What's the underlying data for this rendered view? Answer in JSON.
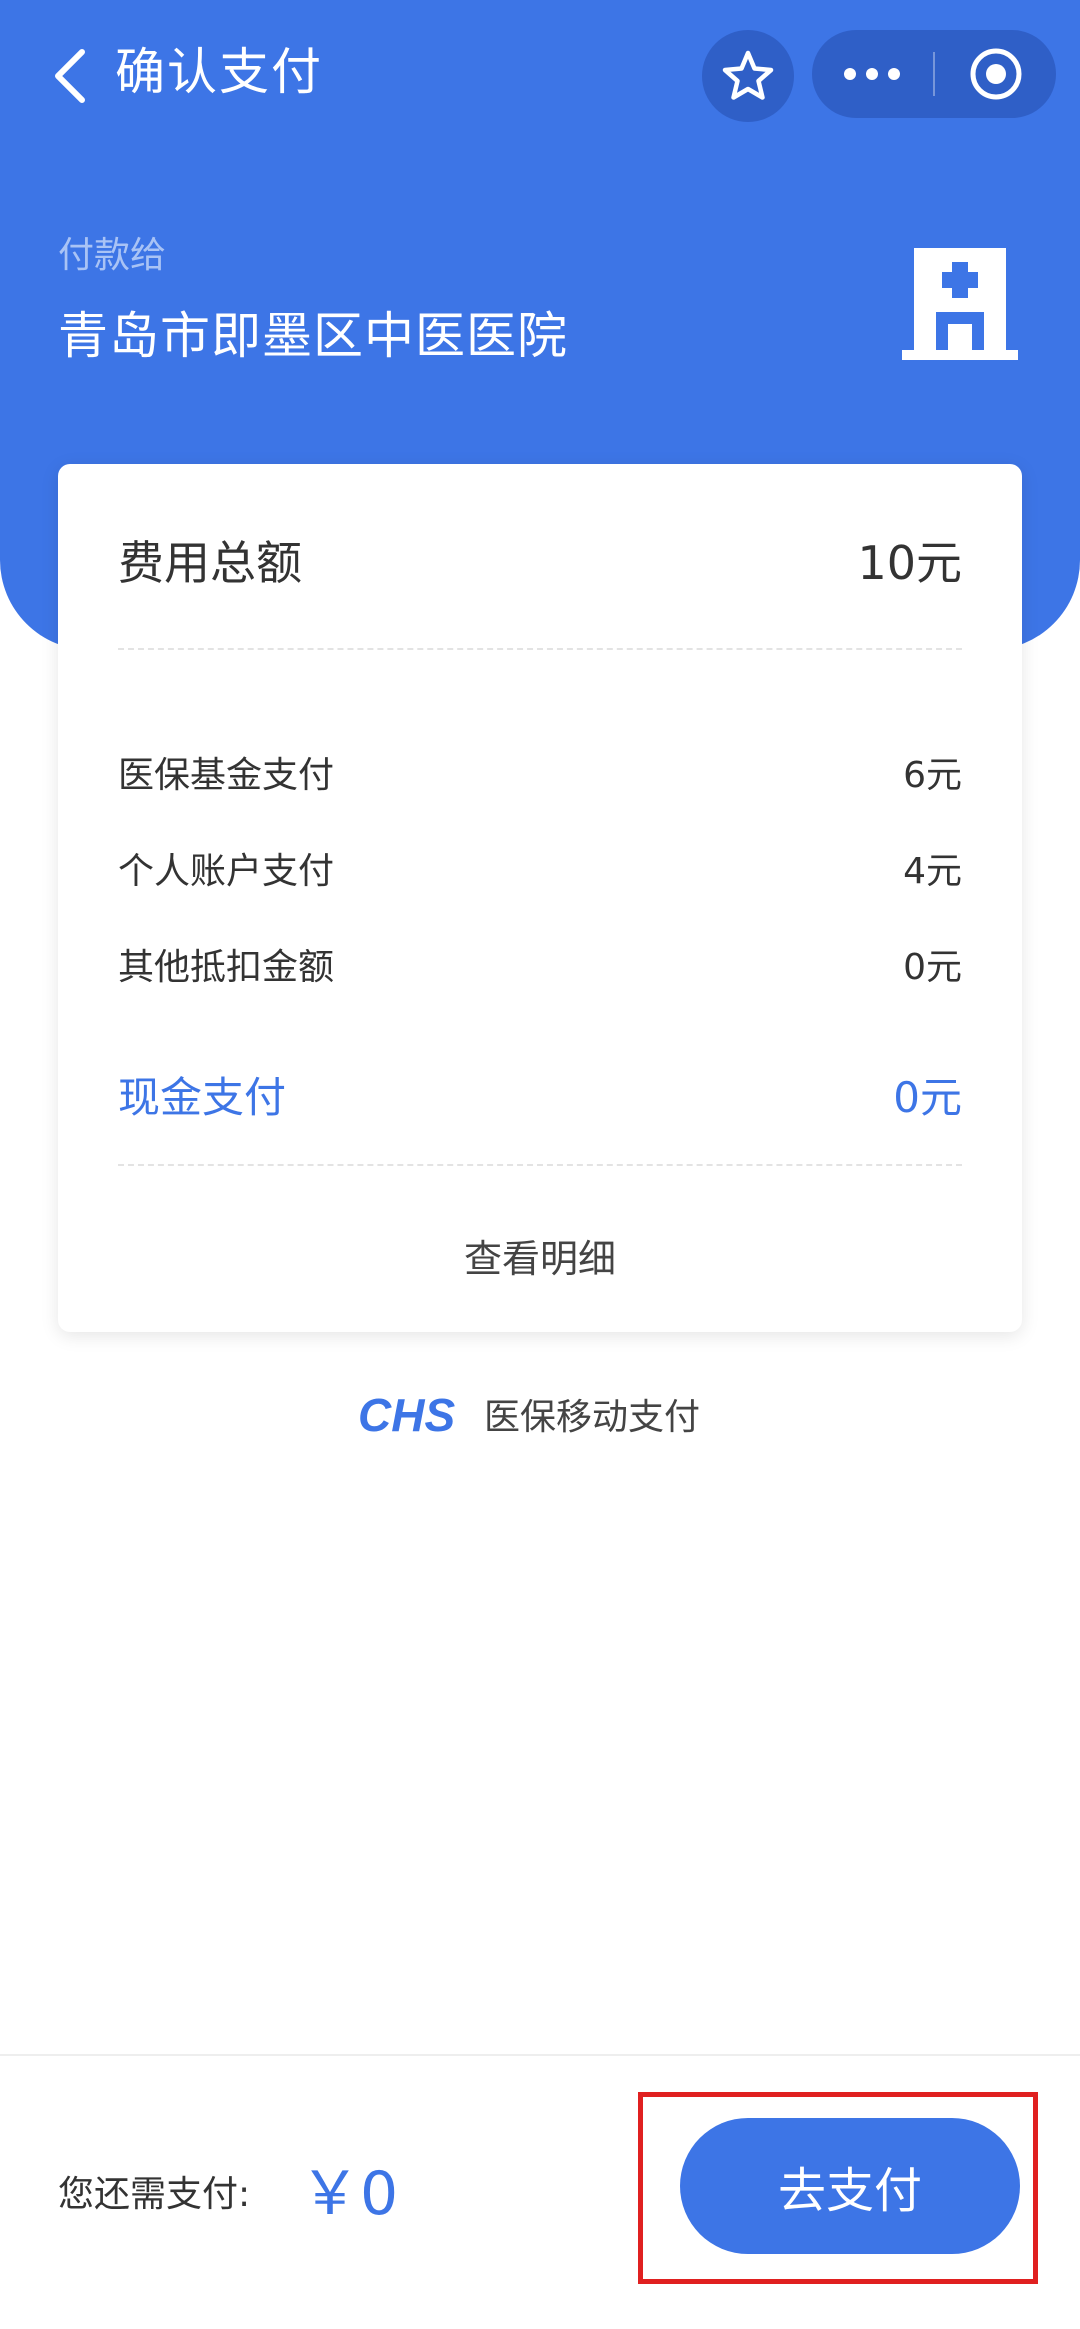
{
  "nav": {
    "title": "确认支付",
    "back_icon": "chevron-left-icon",
    "favorite_icon": "star-icon",
    "more_icon": "more-dots-icon",
    "close_icon": "target-circle-icon"
  },
  "header": {
    "pay_to_label": "付款给",
    "hospital_name": "青岛市即墨区中医医院",
    "hospital_icon": "hospital-icon"
  },
  "summary": {
    "total_label": "费用总额",
    "total_value": "10元",
    "items": [
      {
        "label": "医保基金支付",
        "value": "6元"
      },
      {
        "label": "个人账户支付",
        "value": "4元"
      },
      {
        "label": "其他抵扣金额",
        "value": "0元"
      }
    ],
    "cash_label": "现金支付",
    "cash_value": "0元",
    "detail_link": "查看明细"
  },
  "brand": {
    "logo_text": "CHS",
    "text": "医保移动支付"
  },
  "footer": {
    "remain_label": "您还需支付:",
    "remain_amount": "￥0",
    "pay_button": "去支付"
  },
  "colors": {
    "primary": "#3d75e6",
    "highlight": "#e02020"
  }
}
